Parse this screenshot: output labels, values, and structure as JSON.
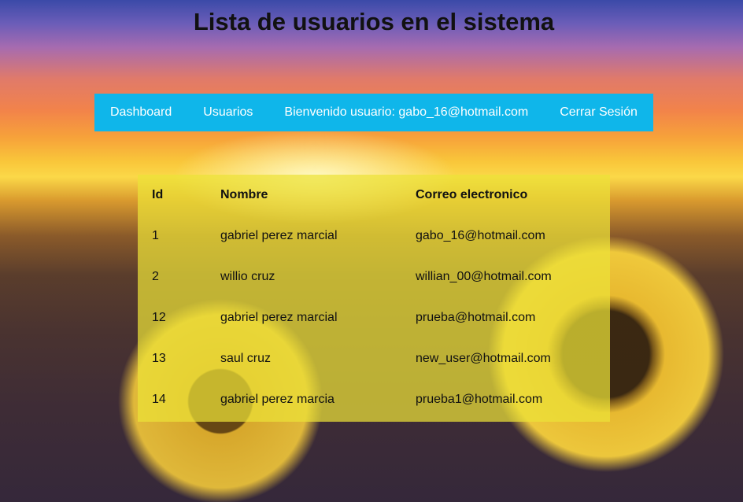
{
  "page": {
    "title": "Lista de usuarios en el sistema"
  },
  "nav": {
    "items": [
      {
        "label": "Dashboard"
      },
      {
        "label": "Usuarios"
      },
      {
        "label": "Bienvenido usuario: gabo_16@hotmail.com"
      },
      {
        "label": "Cerrar Sesión"
      }
    ],
    "background": "#0fb6ea"
  },
  "table": {
    "headers": {
      "id": "Id",
      "name": "Nombre",
      "email": "Correo electronico"
    },
    "rows": [
      {
        "id": "1",
        "name": "gabriel perez marcial",
        "email": "gabo_16@hotmail.com"
      },
      {
        "id": "2",
        "name": "willio cruz",
        "email": "willian_00@hotmail.com"
      },
      {
        "id": "12",
        "name": "gabriel perez marcial",
        "email": "prueba@hotmail.com"
      },
      {
        "id": "13",
        "name": "saul cruz",
        "email": "new_user@hotmail.com"
      },
      {
        "id": "14",
        "name": "gabriel perez marcia",
        "email": "prueba1@hotmail.com"
      }
    ]
  }
}
